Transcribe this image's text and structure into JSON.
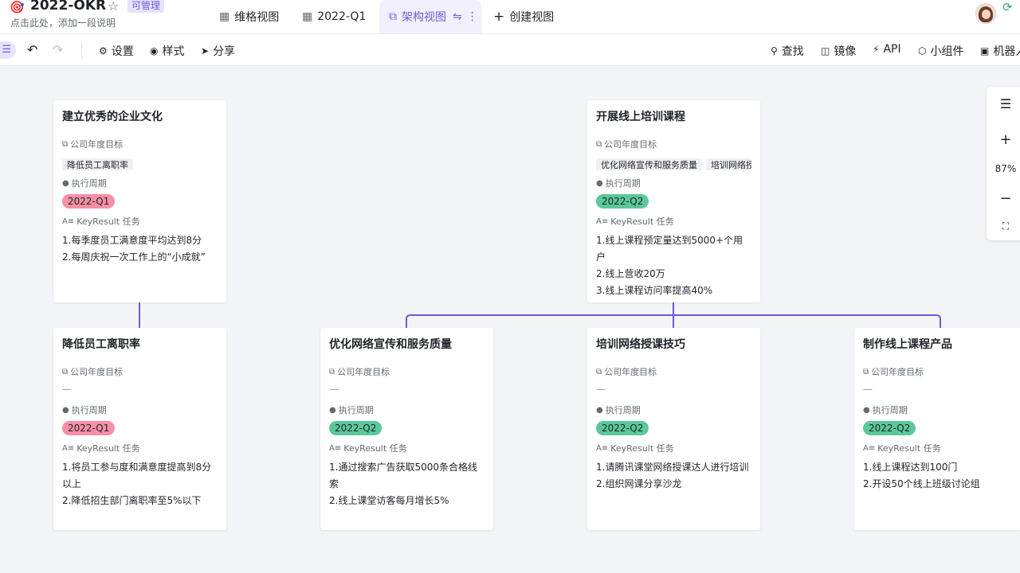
{
  "header": {
    "title_icon": "🎯",
    "title": "2022-OKR",
    "badge": "可管理",
    "subtitle": "点击此处，添加一段说明",
    "tabs": {
      "grid": "维格视图",
      "q1": "2022-Q1",
      "arch": "架构视图",
      "create": "创建视图"
    }
  },
  "toolbar": {
    "settings": "设置",
    "style": "样式",
    "share": "分享",
    "find": "查找",
    "mirror": "镜像",
    "api": "API",
    "widget": "小组件",
    "robot": "机器人"
  },
  "labels": {
    "objective": "公司年度目标",
    "period": "执行周期",
    "kr": "KeyResult 任务",
    "empty": "—"
  },
  "cards": {
    "c1": {
      "title": "建立优秀的企业文化",
      "tags": [
        "降低员工离职率"
      ],
      "period": "2022-Q1",
      "kr": [
        "1.每季度员工满意度平均达到8分",
        "2.每周庆祝一次工作上的“小成就”"
      ]
    },
    "c2": {
      "title": "开展线上培训课程",
      "tags": [
        "优化网络宣传和服务质量",
        "培训网络授课技巧"
      ],
      "period": "2022-Q2",
      "kr": [
        "1.线上课程预定量达到5000+个用户",
        "2.线上营收20万",
        "3.线上课程访问率提高40%"
      ]
    },
    "c3": {
      "title": "降低员工离职率",
      "period": "2022-Q1",
      "kr": [
        "1.将员工参与度和满意度提高到8分以上",
        "2.降低招生部门离职率至5%以下"
      ]
    },
    "c4": {
      "title": "优化网络宣传和服务质量",
      "period": "2022-Q2",
      "kr": [
        "1.通过搜索广告获取5000条合格线索",
        "2.线上课堂访客每月增长5%"
      ]
    },
    "c5": {
      "title": "培训网络授课技巧",
      "period": "2022-Q2",
      "kr": [
        "1.请腾讯课堂网络授课达人进行培训",
        "2.组织网课分享沙龙"
      ]
    },
    "c6": {
      "title": "制作线上课程产品",
      "period": "2022-Q2",
      "kr": [
        "1.线上课程达到100门",
        "2.开设50个线上班级讨论组"
      ]
    }
  },
  "zoom": {
    "level": "87%"
  },
  "colors": {
    "accent": "#6f5bd8",
    "q1": "#f78fa7",
    "q2": "#5bc89a",
    "connector": "#6f5bd8"
  },
  "icons": {
    "objective": "link-icon",
    "period": "circle-dot-icon",
    "kr": "text-icon"
  }
}
